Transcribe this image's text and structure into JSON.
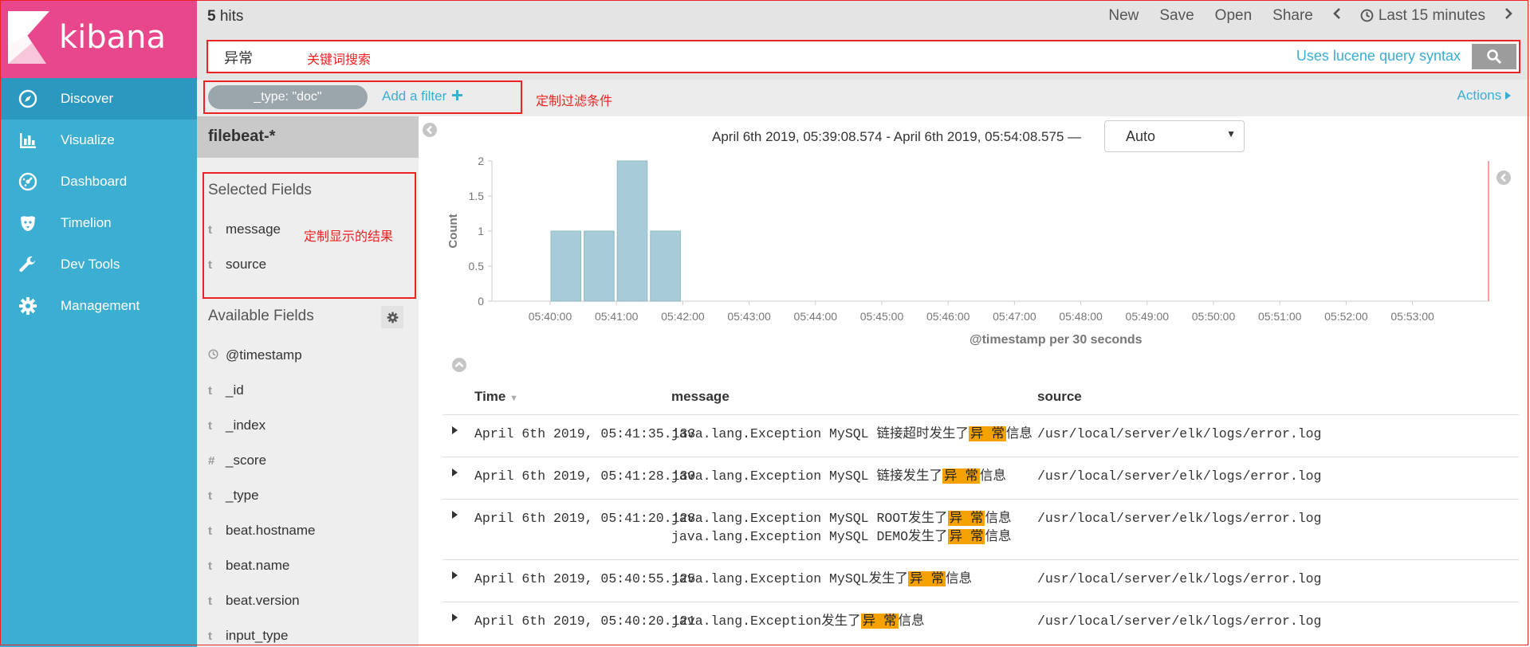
{
  "sidebar": {
    "logo_text": "kibana",
    "items": [
      {
        "label": "Discover",
        "icon": "compass-icon",
        "active": true
      },
      {
        "label": "Visualize",
        "icon": "bar-chart-icon",
        "active": false
      },
      {
        "label": "Dashboard",
        "icon": "dashboard-icon",
        "active": false
      },
      {
        "label": "Timelion",
        "icon": "timelion-icon",
        "active": false
      },
      {
        "label": "Dev Tools",
        "icon": "wrench-icon",
        "active": false
      },
      {
        "label": "Management",
        "icon": "gear-icon",
        "active": false
      }
    ]
  },
  "topbar": {
    "hits_count": "5",
    "hits_label": "hits",
    "menu": [
      "New",
      "Save",
      "Open",
      "Share"
    ],
    "time_label": "Last 15 minutes"
  },
  "search": {
    "value": "异常",
    "annotation": "关键词搜索",
    "lucene_hint": "Uses lucene query syntax"
  },
  "filters": {
    "pill": "_type: \"doc\"",
    "add_filter": "Add a filter",
    "annotation": "定制过滤条件",
    "actions": "Actions"
  },
  "fields_panel": {
    "index_pattern": "filebeat-*",
    "selected_title": "Selected Fields",
    "selected_annotation": "定制显示的结果",
    "selected": [
      {
        "type": "t",
        "name": "message"
      },
      {
        "type": "t",
        "name": "source"
      }
    ],
    "available_title": "Available Fields",
    "available": [
      {
        "type": "clock",
        "name": "@timestamp"
      },
      {
        "type": "t",
        "name": "_id"
      },
      {
        "type": "t",
        "name": "_index"
      },
      {
        "type": "#",
        "name": "_score"
      },
      {
        "type": "t",
        "name": "_type"
      },
      {
        "type": "t",
        "name": "beat.hostname"
      },
      {
        "type": "t",
        "name": "beat.name"
      },
      {
        "type": "t",
        "name": "beat.version"
      },
      {
        "type": "t",
        "name": "input_type"
      }
    ]
  },
  "histogram_header": {
    "range": "April 6th 2019, 05:39:08.574 - April 6th 2019, 05:54:08.575 —",
    "interval": "Auto"
  },
  "chart_data": {
    "type": "bar",
    "title": "",
    "xlabel": "@timestamp per 30 seconds",
    "ylabel": "Count",
    "ylim": [
      0,
      2
    ],
    "yticks": [
      "0",
      "0.5",
      "1",
      "1.5",
      "2"
    ],
    "x_tick_labels": [
      "05:40:00",
      "05:41:00",
      "05:42:00",
      "05:43:00",
      "05:44:00",
      "05:45:00",
      "05:46:00",
      "05:47:00",
      "05:48:00",
      "05:49:00",
      "05:50:00",
      "05:51:00",
      "05:52:00",
      "05:53:00"
    ],
    "categories": [
      "05:40:00",
      "05:40:30",
      "05:41:00",
      "05:41:30"
    ],
    "values": [
      1,
      1,
      2,
      1
    ],
    "bar_color": "#a8ccd7"
  },
  "table": {
    "headers": [
      "Time",
      "message",
      "source"
    ],
    "rows": [
      {
        "time": "April 6th 2019, 05:41:35.133",
        "message": [
          [
            "java.lang.Exception MySQL 链接超时发生了",
            "异 常",
            "信息"
          ]
        ],
        "source": "/usr/local/server/elk/logs/error.log"
      },
      {
        "time": "April 6th 2019, 05:41:28.130",
        "message": [
          [
            "java.lang.Exception MySQL 链接发生了",
            "异 常",
            "信息"
          ]
        ],
        "source": "/usr/local/server/elk/logs/error.log"
      },
      {
        "time": "April 6th 2019, 05:41:20.128",
        "message": [
          [
            "java.lang.Exception MySQL ROOT发生了",
            "异 常",
            "信息"
          ],
          [
            "java.lang.Exception MySQL DEMO发生了",
            "异 常",
            "信息"
          ]
        ],
        "source": "/usr/local/server/elk/logs/error.log"
      },
      {
        "time": "April 6th 2019, 05:40:55.125",
        "message": [
          [
            "java.lang.Exception MySQL发生了",
            "异 常",
            "信息"
          ]
        ],
        "source": "/usr/local/server/elk/logs/error.log"
      },
      {
        "time": "April 6th 2019, 05:40:20.121",
        "message": [
          [
            "java.lang.Exception发生了",
            "异 常",
            "信息"
          ]
        ],
        "source": "/usr/local/server/elk/logs/error.log"
      }
    ]
  },
  "colors": {
    "sidebar": "#3caed2",
    "logo_bg": "#e8488b",
    "link": "#3caed2",
    "highlight": "#f5a100",
    "annotation": "#e22222"
  }
}
